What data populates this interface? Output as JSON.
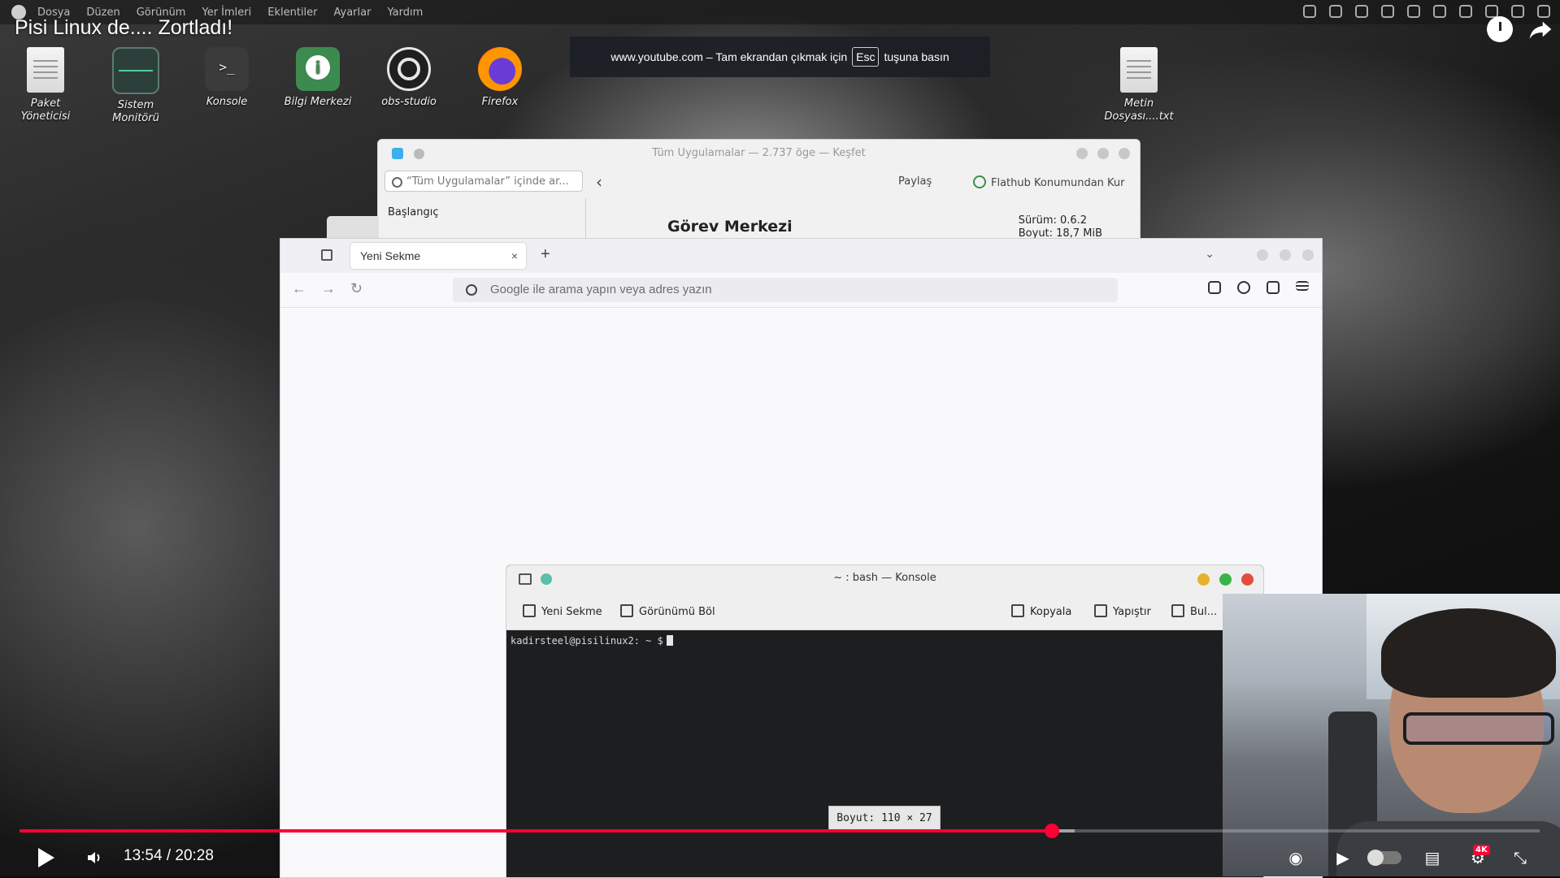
{
  "menubar": {
    "items": [
      "Dosya",
      "Düzen",
      "Görünüm",
      "Yer İmleri",
      "Eklentiler",
      "Ayarlar",
      "Yardım"
    ]
  },
  "video": {
    "title": "Pisi Linux de.... Zortladı!",
    "fullscreen_notice_prefix": "www.youtube.com – Tam ekrandan çıkmak için",
    "fullscreen_notice_key": "Esc",
    "fullscreen_notice_suffix": "tuşuna basın",
    "current_time": "13:54",
    "duration": "20:28",
    "time_display": "13:54 / 20:28",
    "progress_fraction": 0.679,
    "buffered_fraction": 0.694,
    "quality_badge": "4K"
  },
  "desktop": {
    "icons": [
      {
        "label": "Paket\nYöneticisi",
        "icon": "document-icon"
      },
      {
        "label": "Sistem\nMonitörü",
        "icon": "system-monitor-icon"
      },
      {
        "label": "Konsole",
        "icon": "terminal-icon",
        "glyph": ">_"
      },
      {
        "label": "Bilgi Merkezi",
        "icon": "info-center-icon"
      },
      {
        "label": "obs-studio",
        "icon": "obs-icon"
      },
      {
        "label": "Firefox",
        "icon": "firefox-icon"
      },
      {
        "label": "Metin\nDosyası....txt",
        "icon": "text-file-icon"
      }
    ]
  },
  "discover": {
    "title": "Tüm Uygulamalar — 2.737 öge — Keşfet",
    "search_placeholder": "“Tüm Uygulamalar” içinde ar...",
    "share_label": "Paylaş",
    "install_label": "Flathub Konumundan Kur",
    "sidebar_item": "Başlangıç",
    "app_name": "Görev Merkezi",
    "version": "Sürüm: 0.6.2",
    "size": "Boyut: 18,7 MiB"
  },
  "firefox": {
    "tab_title": "Yeni Sekme",
    "tab_close": "×",
    "new_tab": "+",
    "url_placeholder": "Google ile arama yapın veya adres yazın",
    "back": "←",
    "forward": "→",
    "reload": "↻",
    "tab_list": "⌄"
  },
  "konsole": {
    "title": "~ : bash — Konsole",
    "new_tab_label": "Yeni Sekme",
    "split_view_label": "Görünümü Böl",
    "copy_label": "Kopyala",
    "paste_label": "Yapıştır",
    "find_label": "Bul...",
    "prompt": "kadirsteel@pisilinux2: ~ $",
    "size_tooltip": "Boyut: 110 × 27",
    "colors": {
      "minimize": "#e5b32a",
      "maximize": "#3cb34a",
      "close": "#e24d3f"
    }
  },
  "colors": {
    "youtube_red": "#ff0033",
    "terminal_bg": "#1d1e20"
  }
}
